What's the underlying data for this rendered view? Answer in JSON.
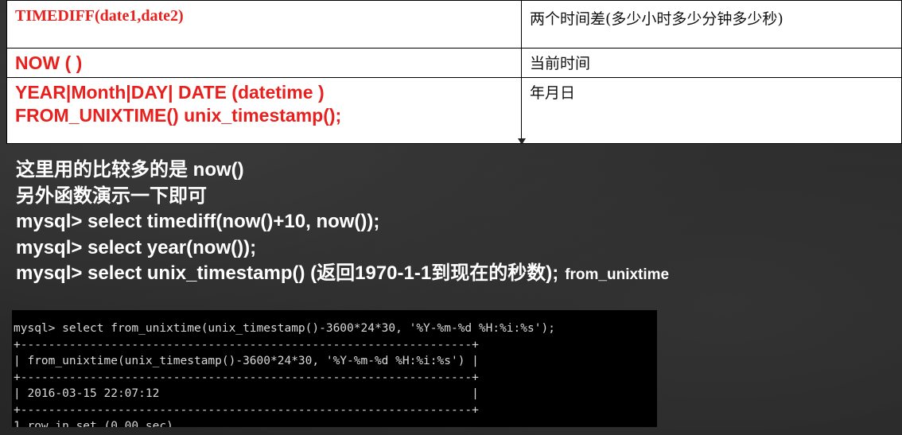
{
  "table": {
    "rows": [
      {
        "func": [
          "TIMEDIFF(date1,date2)"
        ],
        "desc": "两个时间差(多少小时多少分钟多少秒)"
      },
      {
        "func": [
          "NOW (  )"
        ],
        "desc": "当前时间"
      },
      {
        "func": [
          "YEAR|Month|DAY| DATE (datetime )",
          "FROM_UNIXTIME()  unix_timestamp();"
        ],
        "desc": "年月日"
      }
    ]
  },
  "notes": {
    "line1": "这里用的比较多的是 now()",
    "line2": "另外函数演示一下即可",
    "line3": "mysql> select timediff(now()+10, now());",
    "line4": "mysql> select year(now());",
    "line5_main": "mysql> select unix_timestamp() (返回1970-1-1到现在的秒数);",
    "line5_small": "from_unixtime"
  },
  "terminal": {
    "lines": [
      "mysql> select from_unixtime(unix_timestamp()-3600*24*30, '%Y-%m-%d %H:%i:%s');",
      "+-----------------------------------------------------------------+",
      "| from_unixtime(unix_timestamp()-3600*24*30, '%Y-%m-%d %H:%i:%s') |",
      "+-----------------------------------------------------------------+",
      "| 2016-03-15 22:07:12                                             |",
      "+-----------------------------------------------------------------+",
      "1 row in set (0.00 sec)"
    ]
  }
}
